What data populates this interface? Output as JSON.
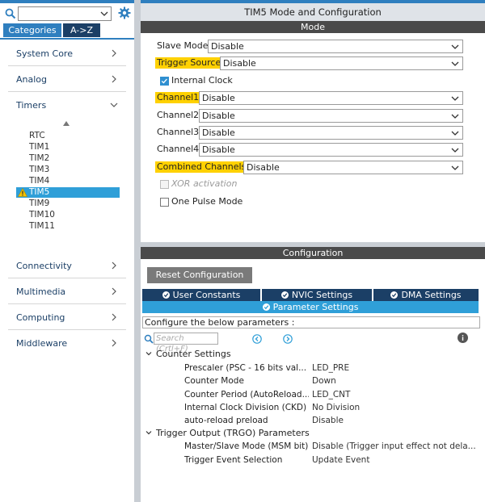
{
  "left": {
    "search": {
      "value": ""
    },
    "tabs": {
      "categories": "Categories",
      "az": "A->Z"
    },
    "categories_top": [
      {
        "label": "System Core",
        "expanded": false
      },
      {
        "label": "Analog",
        "expanded": false
      },
      {
        "label": "Timers",
        "expanded": true
      }
    ],
    "timers": [
      "RTC",
      "TIM1",
      "TIM2",
      "TIM3",
      "TIM4",
      "TIM5",
      "TIM9",
      "TIM10",
      "TIM11"
    ],
    "selected_timer": "TIM5",
    "categories_bottom": [
      {
        "label": "Connectivity"
      },
      {
        "label": "Multimedia"
      },
      {
        "label": "Computing"
      },
      {
        "label": "Middleware"
      }
    ]
  },
  "right": {
    "title": "TIM5 Mode and Configuration",
    "mode_header": "Mode",
    "mode": {
      "slave_mode": {
        "label": "Slave Mode",
        "value": "Disable"
      },
      "trigger_source": {
        "label": "Trigger Source",
        "value": "Disable"
      },
      "internal_clock": {
        "label": "Internal Clock",
        "checked": true
      },
      "channel1": {
        "label": "Channel1",
        "value": "Disable"
      },
      "channel2": {
        "label": "Channel2",
        "value": "Disable"
      },
      "channel3": {
        "label": "Channel3",
        "value": "Disable"
      },
      "channel4": {
        "label": "Channel4",
        "value": "Disable"
      },
      "combined_channels": {
        "label": "Combined Channels",
        "value": "Disable"
      },
      "xor_activation": {
        "label": "XOR activation",
        "checked": false,
        "disabled": true
      },
      "one_pulse_mode": {
        "label": "One Pulse Mode",
        "checked": false
      }
    },
    "config_header": "Configuration",
    "reset_label": "Reset Configuration",
    "config_tabs": [
      "User Constants",
      "NVIC Settings",
      "DMA Settings"
    ],
    "active_tab": "Parameter Settings",
    "description": "Configure the below parameters :",
    "search_placeholder": "Search (Crtl+F)",
    "groups": [
      {
        "name": "Counter Settings",
        "params": [
          {
            "name": "Prescaler (PSC - 16 bits val...",
            "value": "LED_PRE"
          },
          {
            "name": "Counter Mode",
            "value": "Down"
          },
          {
            "name": "Counter Period (AutoReload...",
            "value": "LED_CNT"
          },
          {
            "name": "Internal Clock Division (CKD)",
            "value": "No Division"
          },
          {
            "name": "auto-reload preload",
            "value": "Disable"
          }
        ]
      },
      {
        "name": "Trigger Output (TRGO) Parameters",
        "params": [
          {
            "name": "Master/Slave Mode (MSM bit)",
            "value": "Disable (Trigger input effect not dela..."
          },
          {
            "name": "Trigger Event Selection",
            "value": "Update Event"
          }
        ]
      }
    ]
  },
  "colors": {
    "accent": "#2f7fbf",
    "highlight": "#ffd100",
    "tab_dark": "#1b3f66",
    "tab_active": "#2f9fd8"
  }
}
